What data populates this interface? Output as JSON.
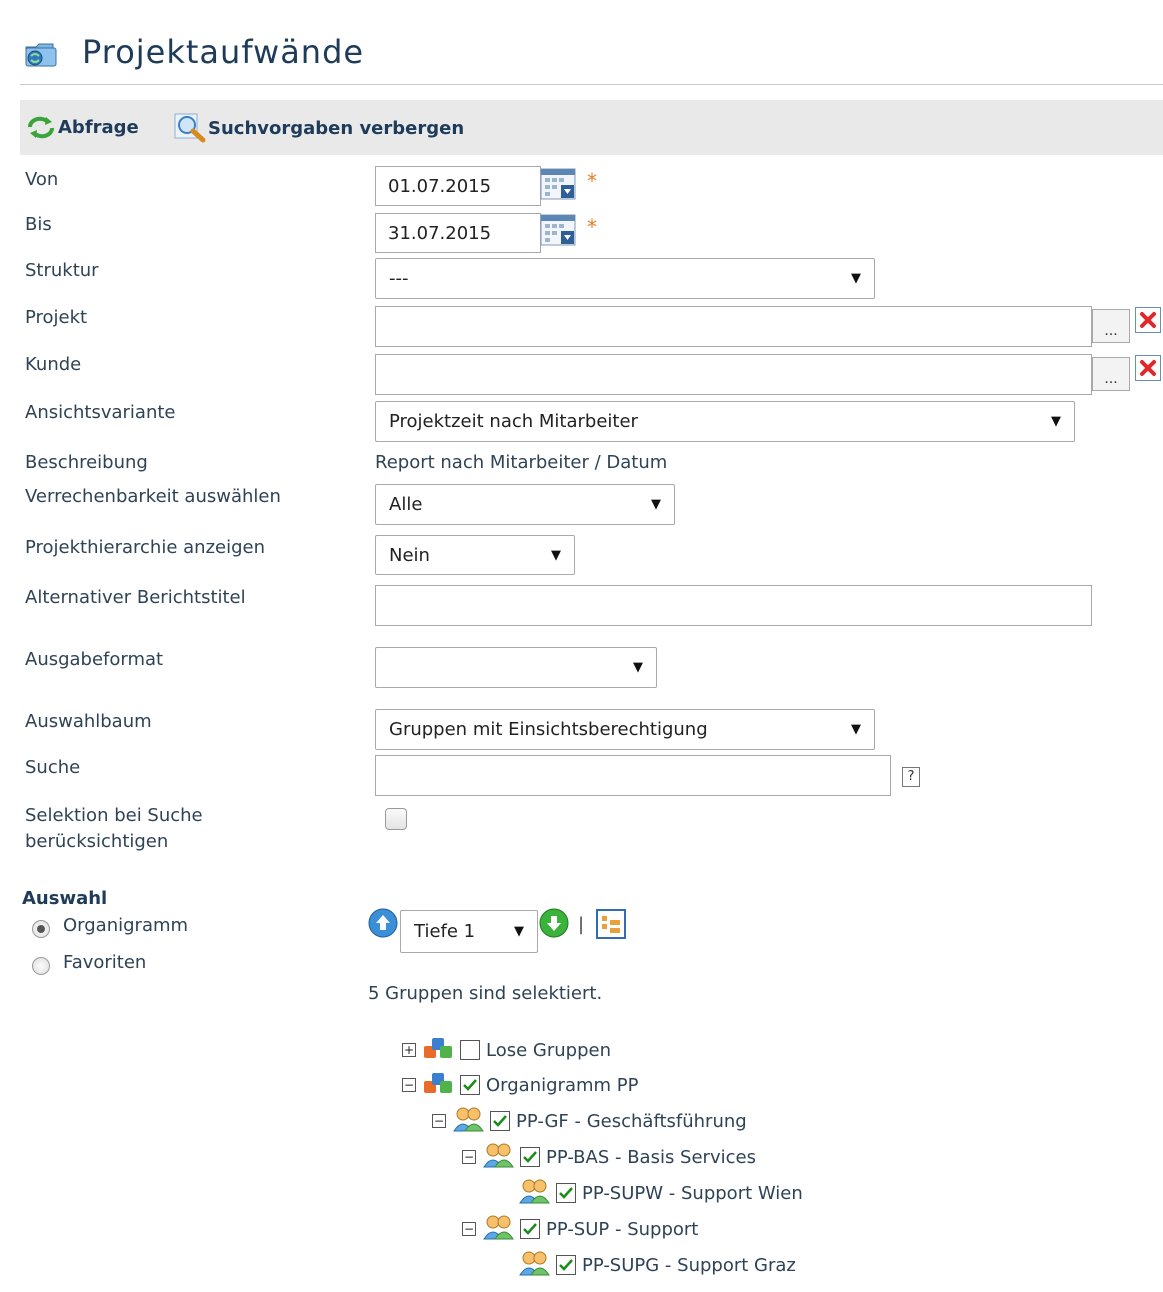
{
  "header": {
    "title": "Projektaufwände",
    "title_icon": "folder-icon"
  },
  "toolbar": {
    "abfrage_label": "Abfrage",
    "suchvorgaben_label": "Suchvorgaben verbergen"
  },
  "form": {
    "von": {
      "label": "Von",
      "value": "01.07.2015",
      "required_mark": "*"
    },
    "bis": {
      "label": "Bis",
      "value": "31.07.2015",
      "required_mark": "*"
    },
    "struktur": {
      "label": "Struktur",
      "value": "---"
    },
    "projekt": {
      "label": "Projekt",
      "value": "",
      "browse_label": "..."
    },
    "kunde": {
      "label": "Kunde",
      "value": "",
      "browse_label": "..."
    },
    "ansichtsvariante": {
      "label": "Ansichtsvariante",
      "value": "Projektzeit nach Mitarbeiter"
    },
    "beschreibung": {
      "label": "Beschreibung",
      "value": "Report nach Mitarbeiter / Datum"
    },
    "verrechenbarkeit": {
      "label": "Verrechenbarkeit auswählen",
      "value": "Alle"
    },
    "projekthierarchie": {
      "label": "Projekthierarchie anzeigen",
      "value": "Nein"
    },
    "berichtstitel": {
      "label": "Alternativer Berichtstitel",
      "value": ""
    },
    "ausgabeformat": {
      "label": "Ausgabeformat",
      "value": ""
    },
    "auswahlbaum": {
      "label": "Auswahlbaum",
      "value": "Gruppen mit Einsichtsberechtigung"
    },
    "suche": {
      "label": "Suche",
      "value": "",
      "help": "?"
    },
    "selektion": {
      "label_line1": "Selektion bei Suche",
      "label_line2": "berücksichtigen",
      "checked": false
    }
  },
  "auswahl": {
    "title": "Auswahl",
    "options": [
      {
        "label": "Organigramm",
        "selected": true
      },
      {
        "label": "Favoriten",
        "selected": false
      }
    ],
    "tiefe": "Tiefe 1",
    "separator": "|",
    "status": "5 Gruppen sind selektiert."
  },
  "tree": [
    {
      "label": "Lose Gruppen",
      "toggle": "+",
      "icon": "blocks-icon",
      "checked": false
    },
    {
      "label": "Organigramm PP",
      "toggle": "−",
      "icon": "blocks-icon",
      "checked": true
    },
    {
      "label": "PP-GF - Geschäftsführung",
      "toggle": "−",
      "icon": "people-icon",
      "checked": true
    },
    {
      "label": "PP-BAS - Basis Services",
      "toggle": "−",
      "icon": "people-icon",
      "checked": true
    },
    {
      "label": "PP-SUPW - Support Wien",
      "toggle": "",
      "icon": "people-icon",
      "checked": true
    },
    {
      "label": "PP-SUP - Support",
      "toggle": "−",
      "icon": "people-icon",
      "checked": true
    },
    {
      "label": "PP-SUPG - Support Graz",
      "toggle": "",
      "icon": "people-icon",
      "checked": true
    }
  ],
  "colors": {
    "accent_dark": "#1f3b5a",
    "required": "#e67e22",
    "delete": "#e3262a",
    "toolbar_bg": "#e9e9e9"
  }
}
